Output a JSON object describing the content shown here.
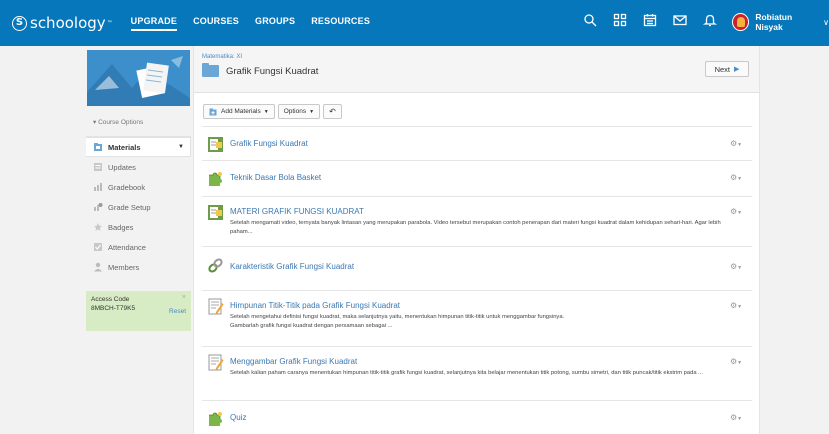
{
  "nav": {
    "logo": "schoology",
    "links": [
      "UPGRADE",
      "COURSES",
      "GROUPS",
      "RESOURCES"
    ],
    "icons": [
      "search-icon",
      "apps-grid-icon",
      "calendar-icon",
      "mail-icon",
      "bell-icon"
    ],
    "user_name": "Robiatun Nisyak",
    "brand_color": "#0677ba"
  },
  "sidebar": {
    "course_options": "Course Options",
    "items": [
      {
        "label": "Materials",
        "icon": "materials-icon"
      },
      {
        "label": "Updates",
        "icon": "updates-icon"
      },
      {
        "label": "Gradebook",
        "icon": "gradebook-icon"
      },
      {
        "label": "Grade Setup",
        "icon": "grade-setup-icon"
      },
      {
        "label": "Badges",
        "icon": "badge-icon"
      },
      {
        "label": "Attendance",
        "icon": "attendance-icon"
      },
      {
        "label": "Members",
        "icon": "members-icon"
      }
    ],
    "access_code_label": "Access Code",
    "access_code": "8MBCH-T79K5",
    "reset": "Reset",
    "access_bg": "#d7ecc5"
  },
  "header": {
    "breadcrumb": "Matematika: XI",
    "title": "Grafik Fungsi Kuadrat",
    "next": "Next"
  },
  "toolbar": {
    "add_materials": "Add Materials",
    "options": "Options"
  },
  "materials": [
    {
      "title": "Grafik Fungsi Kuadrat",
      "icon": "page-icon",
      "desc": ""
    },
    {
      "title": "Teknik Dasar Bola Basket",
      "icon": "puzzle-icon",
      "desc": ""
    },
    {
      "title": "MATERI GRAFIK FUNGSI KUADRAT",
      "icon": "page-icon",
      "desc": "Setelah mengamati video, ternyata banyak lintasan yang merupakan parabola. Video tersebut merupakan contoh penerapan dari materi fungsi kuadrat dalam kehidupan sehari-hari. Agar lebih paham..."
    },
    {
      "title": "Karakteristik Grafik Fungsi Kuadrat",
      "icon": "link-icon",
      "desc": ""
    },
    {
      "title": "Himpunan Titik-Titik pada Grafik Fungsi Kuadrat",
      "icon": "assignment-icon",
      "desc": "Setelah mengetahui definisi fungsi kuadrat, maka selanjutnya yaitu, menentukan himpunan titik-titik untuk menggambar fungsinya.\nGambarlah grafik fungsi kuadrat dengan persamaan sebagai ..."
    },
    {
      "title": "Menggambar Grafik Fungsi Kuadrat",
      "icon": "assignment-icon",
      "desc": "Setelah kalian paham caranya menentukan himpunan titik-titik grafik fungsi kuadrat, selanjutnya kita belajar menentukan titik potong, sumbu simetri, dan titik puncak/titik ekstrim pada ..."
    },
    {
      "title": "Quiz",
      "icon": "puzzle-icon",
      "desc": ""
    }
  ]
}
